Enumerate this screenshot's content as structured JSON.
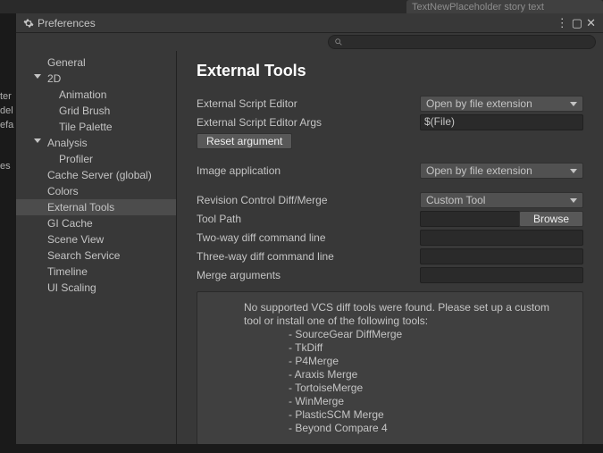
{
  "bg_text": "TextNewPlaceholder story text",
  "window": {
    "title": "Preferences"
  },
  "sidebar": {
    "items": [
      {
        "label": "General"
      },
      {
        "label": "2D"
      },
      {
        "label": "Animation"
      },
      {
        "label": "Grid Brush"
      },
      {
        "label": "Tile Palette"
      },
      {
        "label": "Analysis"
      },
      {
        "label": "Profiler"
      },
      {
        "label": "Cache Server (global)"
      },
      {
        "label": "Colors"
      },
      {
        "label": "External Tools"
      },
      {
        "label": "GI Cache"
      },
      {
        "label": "Scene View"
      },
      {
        "label": "Search Service"
      },
      {
        "label": "Timeline"
      },
      {
        "label": "UI Scaling"
      }
    ]
  },
  "content": {
    "heading": "External Tools",
    "fields": {
      "script_editor_label": "External Script Editor",
      "script_editor_value": "Open by file extension",
      "script_args_label": "External Script Editor Args",
      "script_args_value": "$(File)",
      "reset_btn": "Reset argument",
      "image_app_label": "Image application",
      "image_app_value": "Open by file extension",
      "revision_label": "Revision Control Diff/Merge",
      "revision_value": "Custom Tool",
      "tool_path_label": "Tool Path",
      "browse_btn": "Browse",
      "two_way_label": "Two-way diff command line",
      "three_way_label": "Three-way diff command line",
      "merge_args_label": "Merge arguments"
    },
    "info": {
      "intro": "No supported VCS diff tools were found. Please set up a custom tool or install one of the following tools:",
      "tools": [
        "- SourceGear DiffMerge",
        "- TkDiff",
        "- P4Merge",
        "- Araxis Merge",
        "- TortoiseMerge",
        "- WinMerge",
        "- PlasticSCM Merge",
        "- Beyond Compare 4"
      ]
    }
  },
  "left_strip": [
    "ter",
    "del",
    "efa",
    "es"
  ]
}
